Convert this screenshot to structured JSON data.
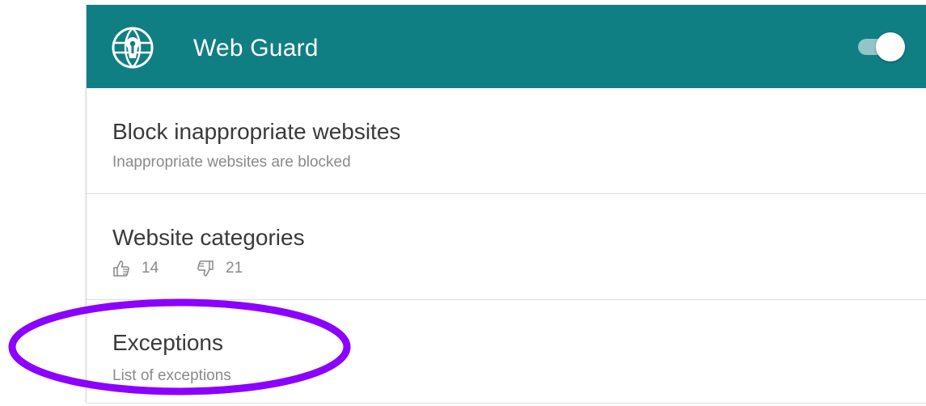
{
  "header": {
    "title": "Web Guard",
    "icon": "globe-keyhole-icon",
    "toggle_on": true,
    "color": "#107f84"
  },
  "settings": {
    "block_websites": {
      "title": "Block inappropriate websites",
      "subtitle": "Inappropriate websites are blocked",
      "toggle_on": true,
      "toggle_color": "#0a7fd2"
    },
    "categories": {
      "title": "Website categories",
      "allowed_icon": "thumbs-up-icon",
      "allowed_count": "14",
      "blocked_icon": "thumbs-down-icon",
      "blocked_count": "21"
    },
    "exceptions": {
      "title": "Exceptions",
      "subtitle": "List of exceptions"
    }
  },
  "annotation": {
    "shape": "ellipse",
    "color": "#8b00ff",
    "target": "exceptions"
  }
}
